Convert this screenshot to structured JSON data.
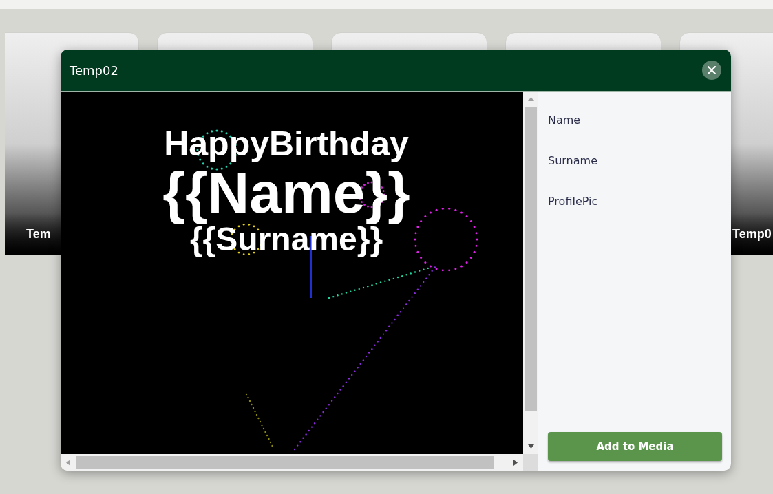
{
  "cards": [
    {
      "label": "Tem"
    },
    {
      "label": "Temp0"
    }
  ],
  "modal": {
    "title": "Temp02",
    "preview_lines": [
      "HappyBirthday",
      "{{Name}}",
      "{{Surname}}"
    ],
    "fields": [
      {
        "label": "Name"
      },
      {
        "label": "Surname"
      },
      {
        "label": "ProfilePic"
      }
    ],
    "button": "Add to Media"
  }
}
